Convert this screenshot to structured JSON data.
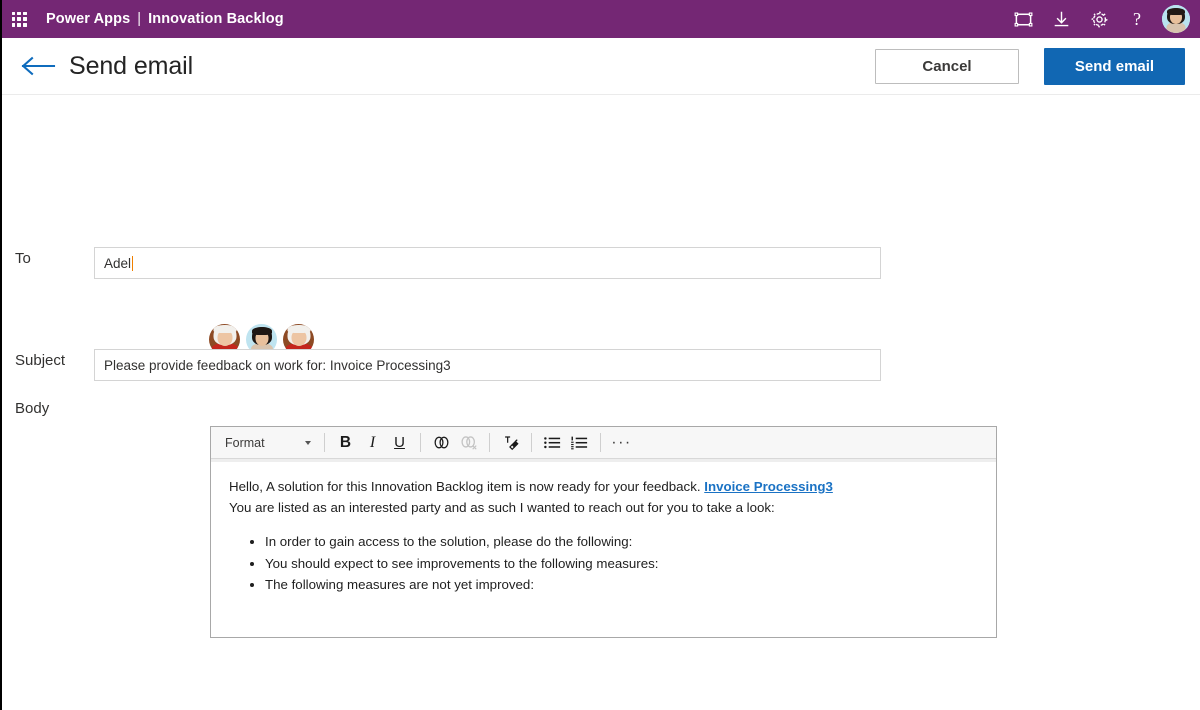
{
  "theme": {
    "suite_bar_bg": "#742774",
    "primary_button_bg": "#1167b3",
    "link_color": "#1a72c4",
    "back_arrow_color": "#0f6cbd",
    "caret_color": "#f08000"
  },
  "suite": {
    "waffle_icon": "waffle-grid-icon",
    "brand": "Power Apps",
    "separator": "|",
    "app_name": "Innovation Backlog",
    "actions": [
      {
        "name": "fullscreen-icon",
        "label": "Full screen"
      },
      {
        "name": "download-icon",
        "label": "Download"
      },
      {
        "name": "gear-icon",
        "label": "Settings"
      },
      {
        "name": "help-icon",
        "label": "?"
      }
    ],
    "account_avatar": "user-avatar"
  },
  "command_bar": {
    "back_icon": "back-arrow-icon",
    "title": "Send email",
    "cancel_label": "Cancel",
    "send_label": "Send email"
  },
  "form": {
    "to": {
      "label": "To",
      "value": "Adel",
      "placeholder": ""
    },
    "recipients": [
      {
        "name": "recipient-avatar-1"
      },
      {
        "name": "recipient-avatar-2"
      },
      {
        "name": "recipient-avatar-3"
      }
    ],
    "subject": {
      "label": "Subject",
      "value": "Please provide feedback on work for: Invoice Processing3",
      "placeholder": ""
    },
    "body": {
      "label": "Body",
      "toolbar": {
        "format_label": "Format",
        "bold_label": "B",
        "italic_label": "I",
        "underline_label": "U",
        "link_icon": "link-icon",
        "unlink_icon": "unlink-icon",
        "clear_format_icon": "clear-formatting-icon",
        "bullet_list_icon": "bulleted-list-icon",
        "numbered_list_icon": "numbered-list-icon",
        "overflow_label": "···"
      },
      "content": {
        "line1_prefix": "Hello, A solution for this Innovation Backlog item is now ready for your feedback. ",
        "line1_link": "Invoice Processing3",
        "line2": "You are listed as an interested party and as such I wanted to reach out for you to take a look:",
        "bullets": [
          "In order to gain access to the solution, please do the following:",
          "You should expect to see improvements to the following measures:",
          "The following measures are not yet improved:"
        ]
      }
    }
  }
}
